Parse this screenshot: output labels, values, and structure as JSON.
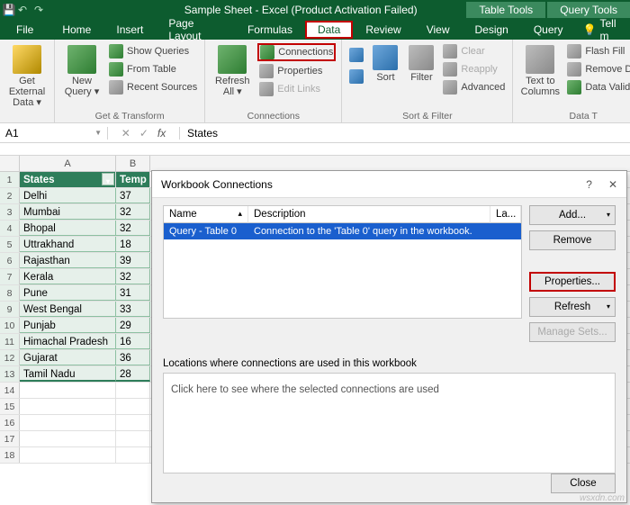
{
  "titlebar": {
    "title": "Sample Sheet - Excel (Product Activation Failed)",
    "table_tools": "Table Tools",
    "query_tools": "Query Tools"
  },
  "tabs": {
    "file": "File",
    "home": "Home",
    "insert": "Insert",
    "page_layout": "Page Layout",
    "formulas": "Formulas",
    "data": "Data",
    "review": "Review",
    "view": "View",
    "design": "Design",
    "query": "Query",
    "tell_me": "Tell m"
  },
  "ribbon": {
    "get_external_data": "Get External\nData ▾",
    "new_query": "New\nQuery ▾",
    "show_queries": "Show Queries",
    "from_table": "From Table",
    "recent_sources": "Recent Sources",
    "group_get_transform": "Get & Transform",
    "refresh_all": "Refresh\nAll ▾",
    "connections": "Connections",
    "properties": "Properties",
    "edit_links": "Edit Links",
    "group_connections": "Connections",
    "sort": "Sort",
    "filter": "Filter",
    "clear": "Clear",
    "reapply": "Reapply",
    "advanced": "Advanced",
    "group_sort_filter": "Sort & Filter",
    "text_to_columns": "Text to\nColumns",
    "flash_fill": "Flash Fill",
    "remove_dupl": "Remove Dupl",
    "data_validation": "Data Validatio",
    "group_data_tools": "Data T"
  },
  "namebox": {
    "ref": "A1"
  },
  "formula": {
    "value": "States"
  },
  "columns": {
    "A": "A",
    "B": "B"
  },
  "table": {
    "headers": {
      "A": "States",
      "B": "Temp"
    },
    "rows": [
      {
        "n": "1"
      },
      {
        "n": "2",
        "a": "Delhi",
        "b": "37"
      },
      {
        "n": "3",
        "a": "Mumbai",
        "b": "32"
      },
      {
        "n": "4",
        "a": "Bhopal",
        "b": "32"
      },
      {
        "n": "5",
        "a": "Uttrakhand",
        "b": "18"
      },
      {
        "n": "6",
        "a": "Rajasthan",
        "b": "39"
      },
      {
        "n": "7",
        "a": "Kerala",
        "b": "32"
      },
      {
        "n": "8",
        "a": "Pune",
        "b": "31"
      },
      {
        "n": "9",
        "a": "West Bengal",
        "b": "33"
      },
      {
        "n": "10",
        "a": "Punjab",
        "b": "29"
      },
      {
        "n": "11",
        "a": "Himachal Pradesh",
        "b": "16"
      },
      {
        "n": "12",
        "a": "Gujarat",
        "b": "36"
      },
      {
        "n": "13",
        "a": "Tamil Nadu",
        "b": "28"
      },
      {
        "n": "14"
      },
      {
        "n": "15"
      },
      {
        "n": "16"
      },
      {
        "n": "17"
      },
      {
        "n": "18"
      }
    ]
  },
  "dialog": {
    "title": "Workbook Connections",
    "help": "?",
    "close_x": "✕",
    "cols": {
      "name": "Name",
      "desc": "Description",
      "la": "La..."
    },
    "row": {
      "name": "Query - Table 0",
      "desc": "Connection to the 'Table 0' query in the workbook."
    },
    "buttons": {
      "add": "Add...",
      "remove": "Remove",
      "properties": "Properties...",
      "refresh": "Refresh",
      "manage": "Manage Sets..."
    },
    "locations_label": "Locations where connections are used in this workbook",
    "locations_hint": "Click here to see where the selected connections are used",
    "close": "Close"
  },
  "watermark": "wsxdn.com"
}
